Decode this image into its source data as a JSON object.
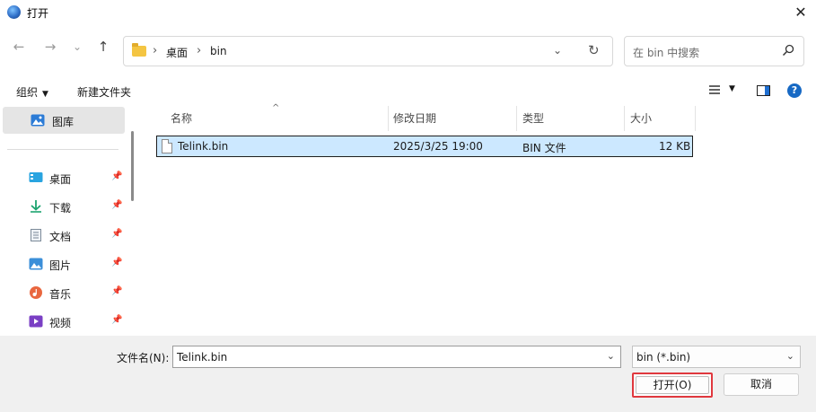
{
  "window": {
    "title": "打开",
    "close_glyph": "✕"
  },
  "nav": {
    "back_glyph": "←",
    "forward_glyph": "→",
    "recent_glyph": "⌄",
    "up_glyph": "↑",
    "breadcrumb": [
      "桌面",
      "bin"
    ],
    "crumb_sep": "›",
    "address_dropdown_glyph": "⌄",
    "refresh_glyph": "↻",
    "search_placeholder": "在 bin 中搜索"
  },
  "commands": {
    "organize": "组织",
    "organize_caret": "▼",
    "new_folder": "新建文件夹",
    "view_caret": "▼",
    "help": "?"
  },
  "sidebar": {
    "items": [
      {
        "label": "图库",
        "icon": "gallery-icon",
        "selected": true
      },
      {
        "label": "桌面",
        "icon": "desktop-icon",
        "pinned": true
      },
      {
        "label": "下载",
        "icon": "download-icon",
        "pinned": true
      },
      {
        "label": "文档",
        "icon": "document-icon",
        "pinned": true
      },
      {
        "label": "图片",
        "icon": "pictures-icon",
        "pinned": true
      },
      {
        "label": "音乐",
        "icon": "music-icon",
        "pinned": true
      },
      {
        "label": "视频",
        "icon": "video-icon",
        "pinned": true
      }
    ],
    "pin_glyph": "📌"
  },
  "filelist": {
    "columns": [
      "名称",
      "修改日期",
      "类型",
      "大小"
    ],
    "sort_glyph": "^",
    "rows": [
      {
        "name": "Telink.bin",
        "modified": "2025/3/25 19:00",
        "type": "BIN 文件",
        "size": "12 KB",
        "selected": true
      }
    ]
  },
  "footer": {
    "filename_label": "文件名(N):",
    "filename_value": "Telink.bin",
    "filetype_value": "bin (*.bin)",
    "dropdown_glyph": "⌄",
    "open_label": "打开(O)",
    "cancel_label": "取消"
  },
  "colors": {
    "selection": "#cce8ff",
    "accent": "#1769c4",
    "highlight_border": "#e0383e"
  }
}
